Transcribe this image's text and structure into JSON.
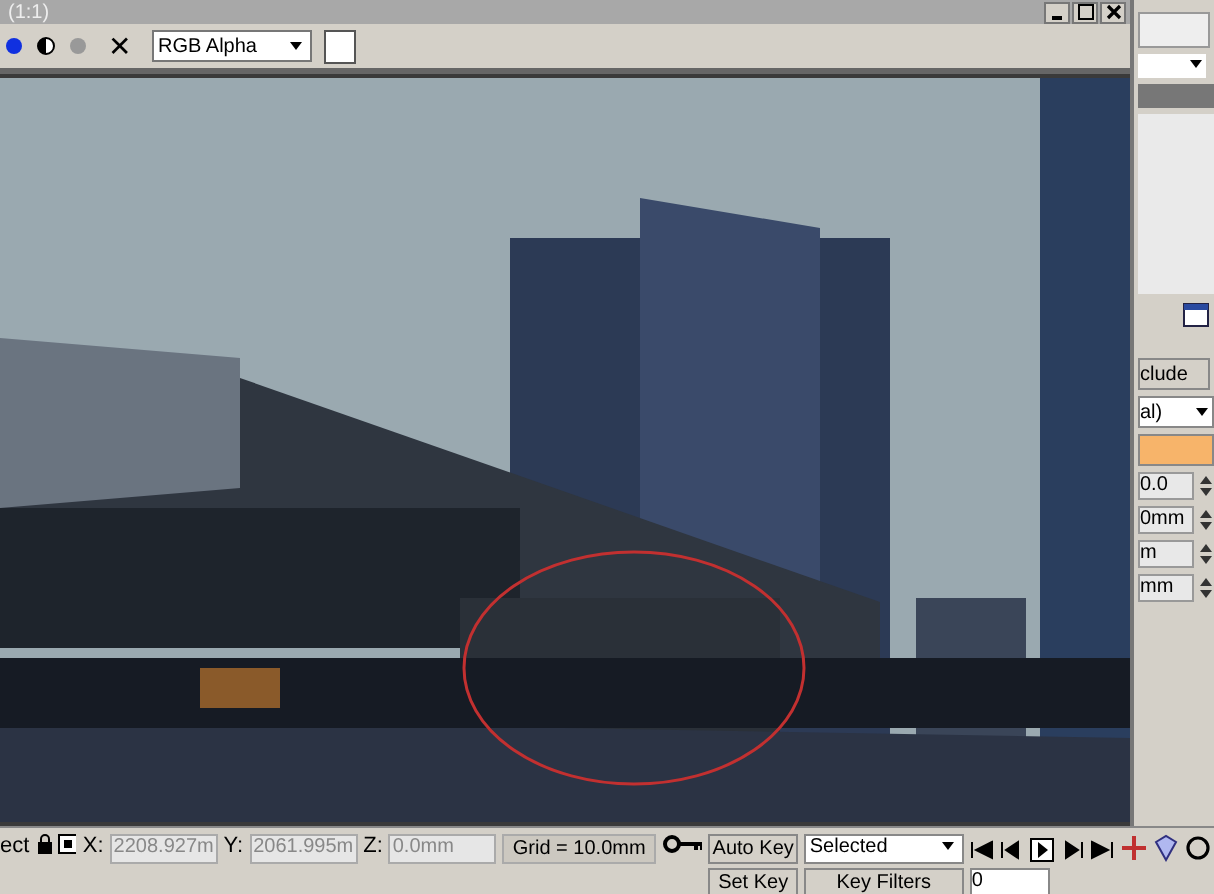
{
  "window": {
    "title": "(1:1)"
  },
  "toolbar": {
    "channel": "RGB Alpha",
    "clear": "✕"
  },
  "side_panel": {
    "labels": [
      "clude",
      "al)",
      "0.0",
      "0mm",
      "m",
      "mm"
    ]
  },
  "status_bar": {
    "mode": "ect",
    "x_label": "X:",
    "x": "2208.927m",
    "y_label": "Y:",
    "y": "2061.995m",
    "z_label": "Z:",
    "z": "0.0mm",
    "grid": "Grid = 10.0mm",
    "auto_key": "Auto Key",
    "selection": "Selected",
    "set_key": "Set Key",
    "key_filters": "Key Filters",
    "frame": "0"
  }
}
